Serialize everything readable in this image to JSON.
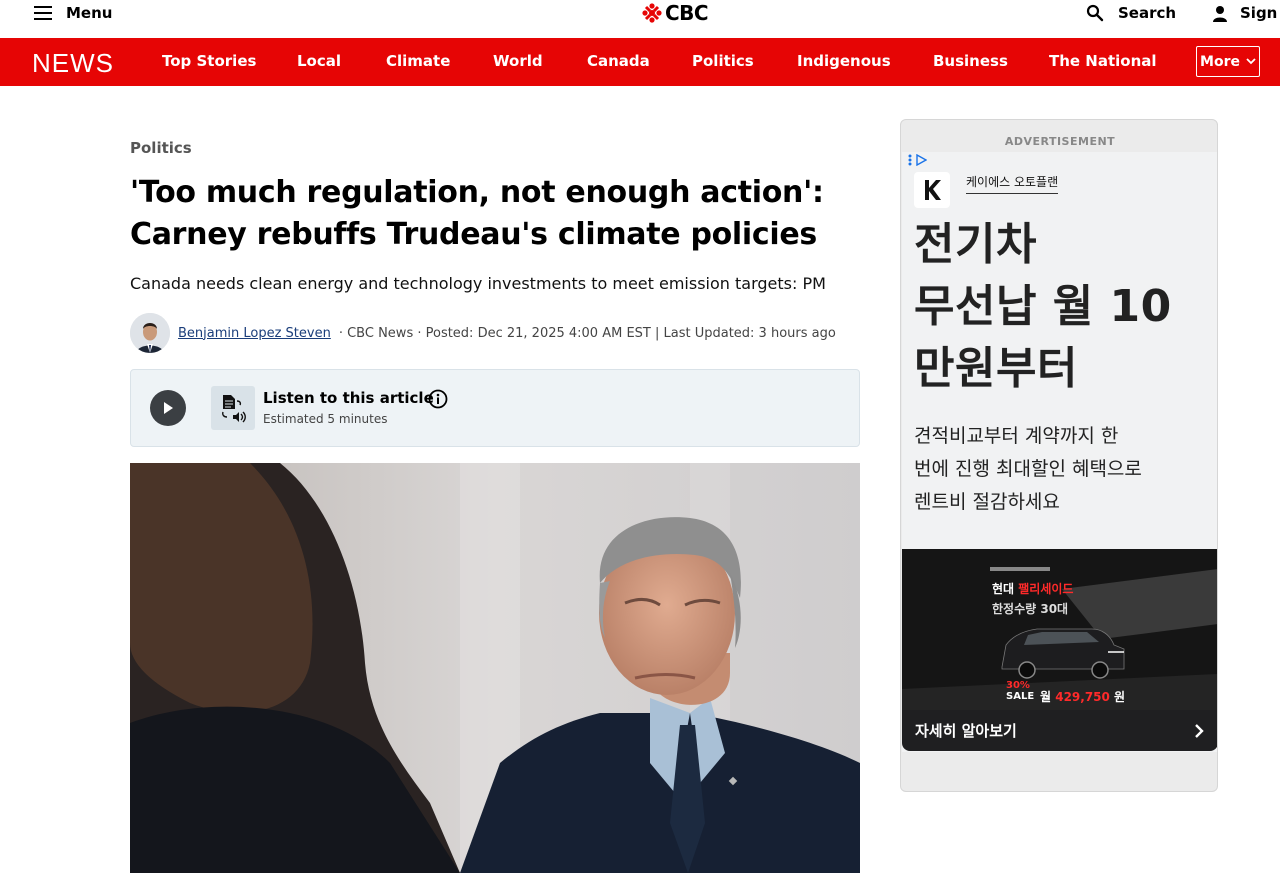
{
  "topbar": {
    "menu_label": "Menu",
    "logo_text": "CBC",
    "search_label": "Search",
    "sign_label": "Sign"
  },
  "nav": {
    "brand": "NEWS",
    "items": [
      "Top Stories",
      "Local",
      "Climate",
      "World",
      "Canada",
      "Politics",
      "Indigenous",
      "Business",
      "The National"
    ],
    "more_label": "More"
  },
  "article": {
    "section": "Politics",
    "headline_line1": "'Too much regulation, not enough action':",
    "headline_line2": "Carney rebuffs Trudeau's climate policies",
    "deck": "Canada needs clean energy and technology investments to meet emission targets: PM",
    "author": "Benjamin Lopez Steven",
    "byline_meta": "· CBC News · Posted: Dec 21, 2025 4:00 AM EST | Last Updated: 3 hours ago",
    "listen": {
      "title": "Listen to this article",
      "subtitle": "Estimated 5 minutes"
    }
  },
  "ad": {
    "label": "ADVERTISEMENT",
    "brand_name": "케이에스 오토플랜",
    "headline_lines": [
      "전기차",
      "무선납 월 10",
      "만원부터"
    ],
    "text_lines": [
      "견적비교부터 계약까지 한",
      "번에 진행 최대할인 혜택으로",
      "렌트비 절감하세요"
    ],
    "image": {
      "line1_a": "현대 ",
      "line1_b": "팰리세이드",
      "line2": "한정수량 30대",
      "discount": "30%",
      "sale": "SALE",
      "price_prefix": "월 ",
      "price": "429,750",
      "price_unit": " 원"
    },
    "cta": "자세히 알아보기"
  },
  "colors": {
    "nav_red": "#e60505",
    "link_blue": "#1a3d7a",
    "listen_bg": "#eef3f6"
  }
}
